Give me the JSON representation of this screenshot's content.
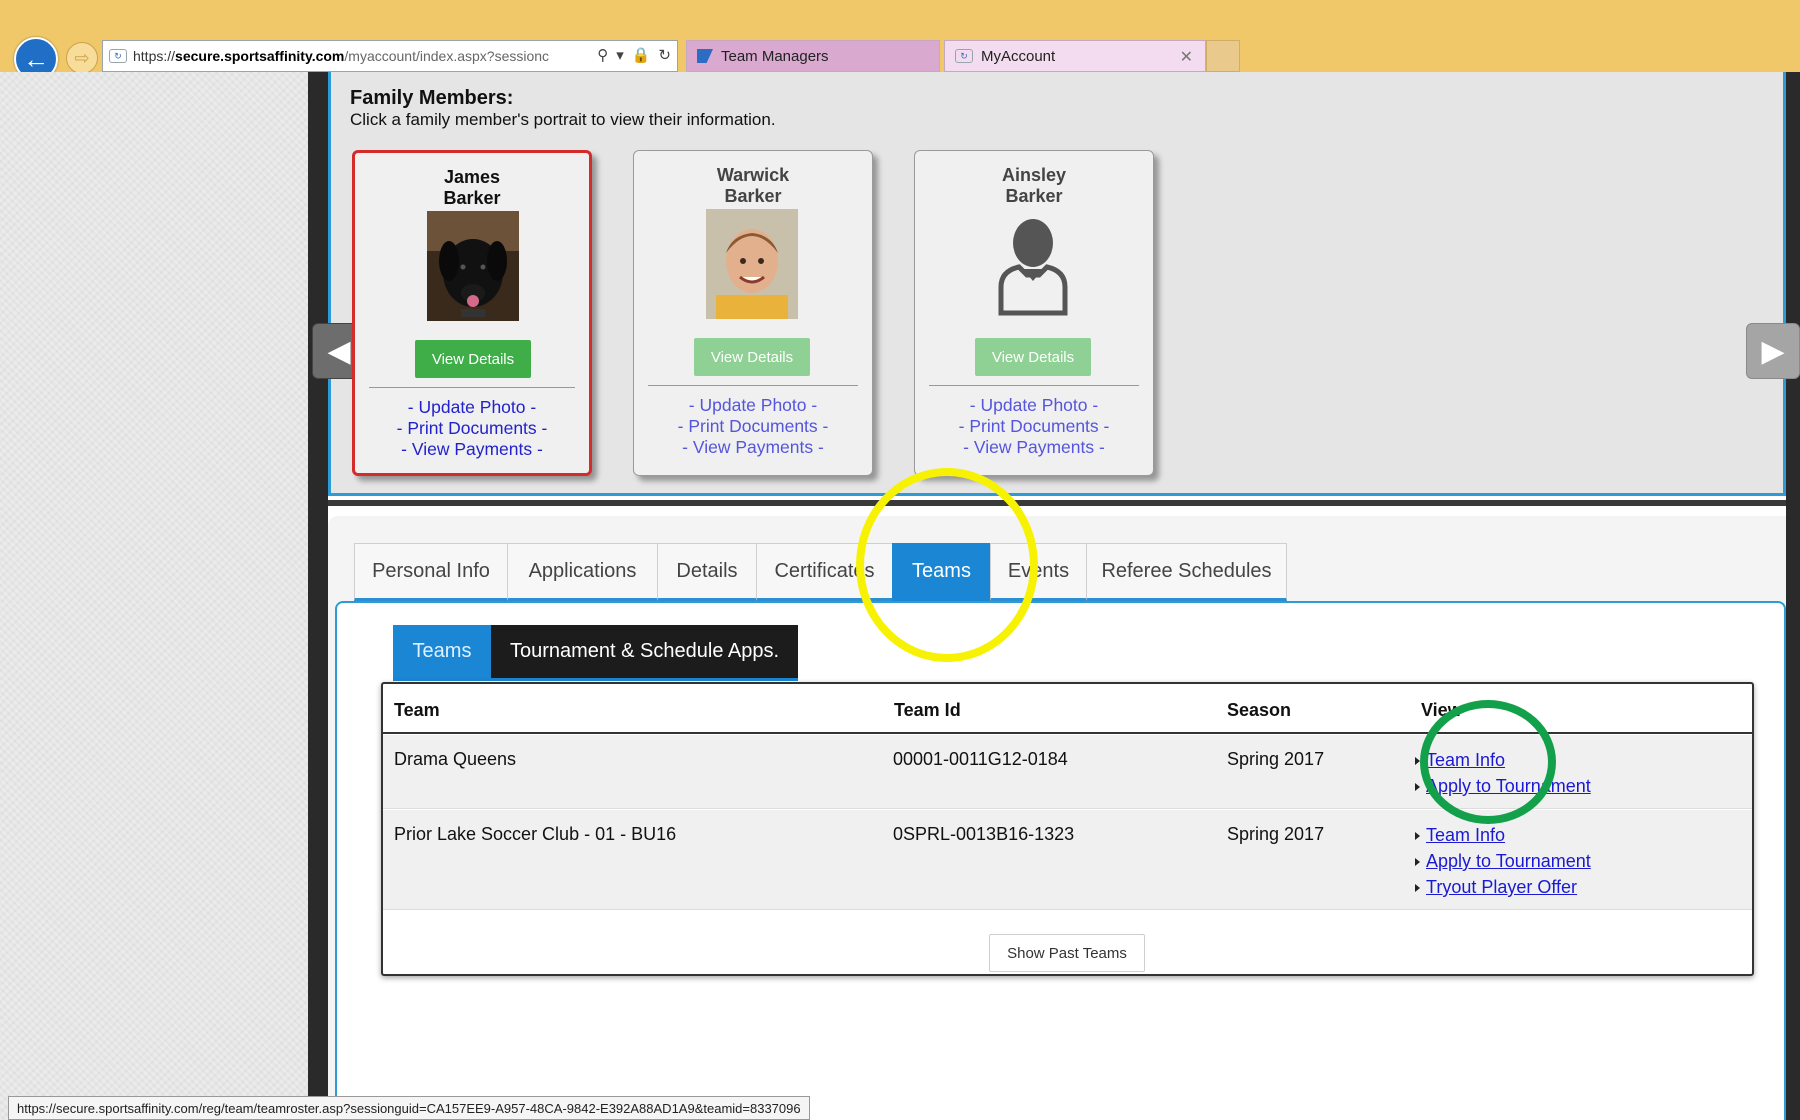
{
  "browser": {
    "url_scheme": "https://",
    "url_host": "secure.sportsaffinity.com",
    "url_path": "/myaccount/index.aspx?sessionc",
    "tabs": [
      {
        "label": "Team Managers"
      },
      {
        "label": "MyAccount"
      }
    ],
    "status_url": "https://secure.sportsaffinity.com/reg/team/teamroster.asp?sessionguid=CA157EE9-A957-48CA-9842-E392A88AD1A9&teamid=8337096"
  },
  "family": {
    "title": "Family Members:",
    "subtitle": "Click a family member's portrait to view their information.",
    "members": [
      {
        "first": "James",
        "last": "Barker",
        "button": "View Details",
        "links": [
          "- Update Photo -",
          "- Print Documents -",
          "- View Payments -"
        ],
        "selected": true
      },
      {
        "first": "Warwick",
        "last": "Barker",
        "button": "View Details",
        "links": [
          "- Update Photo -",
          "- Print Documents -",
          "- View Payments -"
        ],
        "selected": false
      },
      {
        "first": "Ainsley",
        "last": "Barker",
        "button": "View Details",
        "links": [
          "- Update Photo -",
          "- Print Documents -",
          "- View Payments -"
        ],
        "selected": false
      }
    ]
  },
  "main_tabs": [
    "Personal Info",
    "Applications",
    "Details",
    "Certificates",
    "Teams",
    "Events",
    "Referee Schedules"
  ],
  "active_main_tab": "Teams",
  "sub_tabs": [
    "Teams",
    "Tournament & Schedule Apps."
  ],
  "teams_table": {
    "headers": [
      "Team",
      "Team Id",
      "Season",
      "View"
    ],
    "rows": [
      {
        "team": "Drama Queens",
        "team_id": "00001-0011G12-0184",
        "season": "Spring 2017",
        "links": [
          "Team Info",
          "Apply to Tournament"
        ]
      },
      {
        "team": "Prior Lake Soccer Club - 01 - BU16",
        "team_id": "0SPRL-0013B16-1323",
        "season": "Spring 2017",
        "links": [
          "Team Info",
          "Apply to Tournament",
          "Tryout Player Offer"
        ]
      }
    ],
    "show_past_label": "Show Past Teams"
  },
  "colors": {
    "chrome": "#f0c86a",
    "accent_blue": "#1b86d3",
    "selected_border": "#d42b2b",
    "button_green": "#3fae49",
    "annotation_yellow": "#f7f204",
    "annotation_green": "#13a04a"
  }
}
